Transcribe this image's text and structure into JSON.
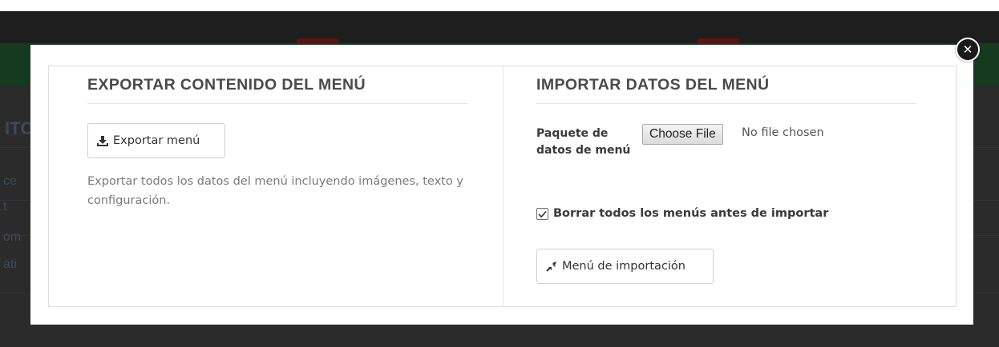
{
  "backdrop": {
    "fragments": [
      "ITC",
      "ce",
      "t",
      "om",
      "ati"
    ]
  },
  "modal": {
    "close_icon": "close-icon",
    "export": {
      "title": "EXPORTAR CONTENIDO DEL MENÚ",
      "button_label": "Exportar menú",
      "button_icon": "download-icon",
      "description": "Exportar todos los datos del menú incluyendo imágenes, texto y configuración."
    },
    "import": {
      "title": "IMPORTAR DATOS DEL MENÚ",
      "field_label": "Paquete de datos de menú",
      "file_button_label": "Choose File",
      "file_status": "No file chosen",
      "checkbox_label": "Borrar todos los menús antes de importar",
      "checkbox_checked": true,
      "button_label": "Menú de importación",
      "button_icon": "import-icon"
    }
  },
  "colors": {
    "overlay": "#2a2a2a",
    "title": "#4a4a4a",
    "description": "#7a7a7a"
  }
}
